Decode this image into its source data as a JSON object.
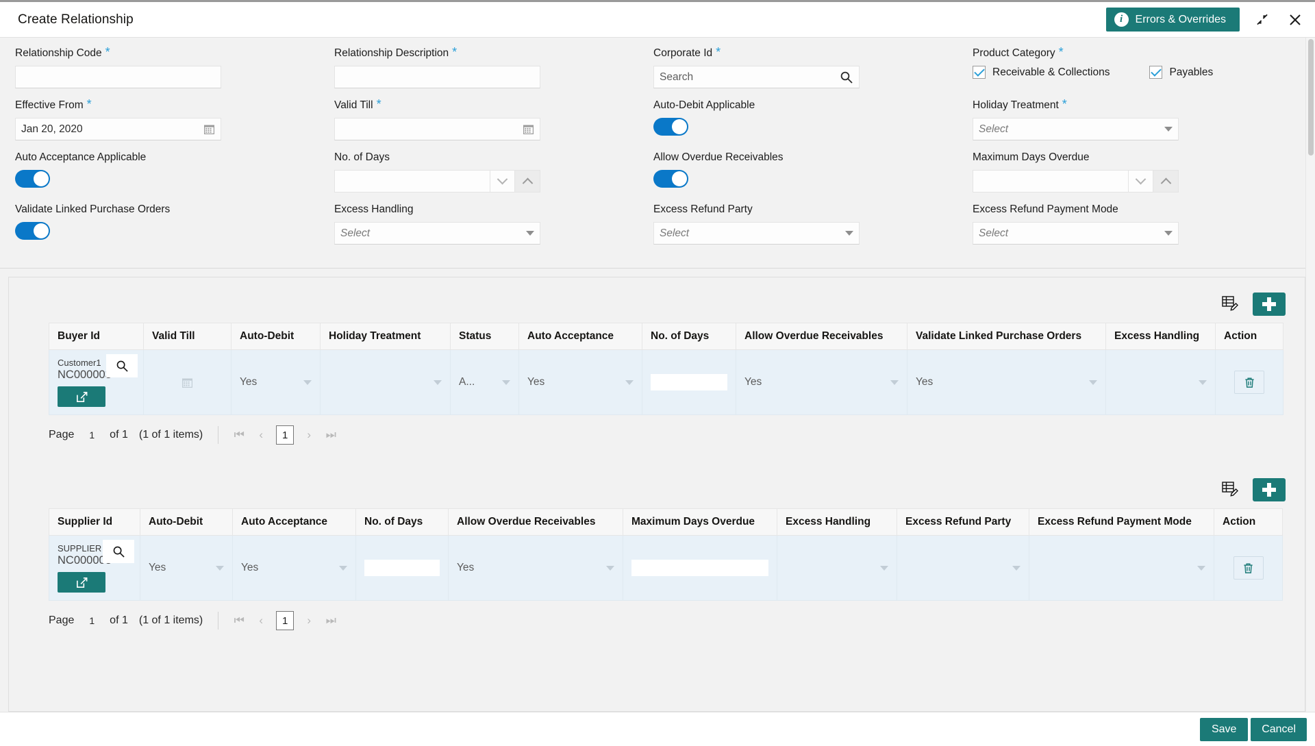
{
  "window": {
    "title": "Create Relationship",
    "errors_button": "Errors & Overrides",
    "minimize_icon": "collapse-icon",
    "close_icon": "close-icon"
  },
  "form": {
    "relationship_code": {
      "label": "Relationship Code",
      "required": true,
      "value": ""
    },
    "relationship_description": {
      "label": "Relationship Description",
      "required": true,
      "value": ""
    },
    "corporate_id": {
      "label": "Corporate Id",
      "required": true,
      "placeholder": "Search",
      "value": ""
    },
    "product_category": {
      "label": "Product Category",
      "required": true,
      "options": [
        {
          "label": "Receivable & Collections",
          "checked": true
        },
        {
          "label": "Payables",
          "checked": true
        }
      ]
    },
    "effective_from": {
      "label": "Effective From",
      "required": true,
      "value": "Jan 20, 2020"
    },
    "valid_till": {
      "label": "Valid Till",
      "required": true,
      "value": ""
    },
    "auto_debit_applicable": {
      "label": "Auto-Debit Applicable",
      "on": true
    },
    "holiday_treatment": {
      "label": "Holiday Treatment",
      "required": true,
      "value": "Select"
    },
    "auto_acceptance_applicable": {
      "label": "Auto Acceptance Applicable",
      "on": true
    },
    "no_of_days": {
      "label": "No. of Days",
      "value": ""
    },
    "allow_overdue_receivables": {
      "label": "Allow Overdue Receivables",
      "on": true
    },
    "maximum_days_overdue": {
      "label": "Maximum Days Overdue",
      "value": ""
    },
    "validate_linked_purchase_orders": {
      "label": "Validate Linked Purchase Orders",
      "on": true
    },
    "excess_handling": {
      "label": "Excess Handling",
      "value": "Select"
    },
    "excess_refund_party": {
      "label": "Excess Refund Party",
      "value": "Select"
    },
    "excess_refund_payment_mode": {
      "label": "Excess Refund Payment Mode",
      "value": "Select"
    }
  },
  "buyer_grid": {
    "columns": [
      "Buyer Id",
      "Valid Till",
      "Auto-Debit",
      "Holiday Treatment",
      "Status",
      "Auto Acceptance",
      "No. of Days",
      "Allow Overdue Receivables",
      "Validate Linked Purchase Orders",
      "Excess Handling",
      "Action"
    ],
    "row": {
      "buyer_id_label": "Customer1",
      "buyer_id_value": "NC000003",
      "valid_till": "",
      "auto_debit": "Yes",
      "holiday_treatment": "",
      "status": "A...",
      "auto_acceptance": "Yes",
      "no_of_days": "",
      "allow_overdue_receivables": "Yes",
      "validate_linked_purchase_orders": "Yes",
      "excess_handling": ""
    },
    "pager": {
      "page_label": "Page",
      "page_number": "1",
      "of_label": "of 1",
      "items_label": "(1 of 1 items)",
      "current_page": "1"
    }
  },
  "supplier_grid": {
    "columns": [
      "Supplier Id",
      "Auto-Debit",
      "Auto Acceptance",
      "No. of Days",
      "Allow Overdue Receivables",
      "Maximum Days Overdue",
      "Excess Handling",
      "Excess Refund Party",
      "Excess Refund Payment Mode",
      "Action"
    ],
    "row": {
      "supplier_id_label": "SUPPLIER",
      "supplier_id_value": "NC000003",
      "auto_debit": "Yes",
      "auto_acceptance": "Yes",
      "no_of_days": "",
      "allow_overdue_receivables": "Yes",
      "maximum_days_overdue": "",
      "excess_handling": "",
      "excess_refund_party": "",
      "excess_refund_payment_mode": ""
    },
    "pager": {
      "page_label": "Page",
      "page_number": "1",
      "of_label": "of 1",
      "items_label": "(1 of 1 items)",
      "current_page": "1"
    }
  },
  "footer": {
    "save": "Save",
    "cancel": "Cancel"
  },
  "colors": {
    "accent_teal": "#1b7a77",
    "toggle_blue": "#0a78c8",
    "required_star": "#2a9fd8",
    "row_bg": "#e8f1f8"
  }
}
